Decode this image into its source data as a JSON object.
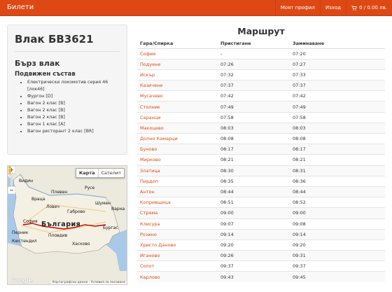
{
  "nav": {
    "brand": "Билети",
    "profile": "Моят профил",
    "logout": "Изход",
    "cart": "0 / 0.00 лв."
  },
  "train": {
    "title": "Влак БВ3621",
    "type": "Бърз влак",
    "composition_title": "Подвижен състав",
    "composition": [
      "Електрически локомотив серия 46 [лок46]",
      "Фургон [D]",
      "Вагон 2 клас [B]",
      "Вагон 2 клас [B]",
      "Вагон 2 клас [B]",
      "Вагон 1 клас [A]",
      "Вагон ресторант 2 клас [BR]"
    ]
  },
  "map": {
    "tab_map": "Карта",
    "tab_satellite": "Сателит",
    "country": "България",
    "labels": [
      "Видин",
      "Враца",
      "Плевен",
      "Русе",
      "Ловеч",
      "Габрово",
      "Шумен",
      "Варна",
      "Перник",
      "София",
      "Пловдив",
      "Бургас",
      "Кюстендил",
      "Хасково"
    ],
    "attribution": "Картографски данни - Условия за ползване",
    "google": "Google",
    "route_color": "#cc0000"
  },
  "route": {
    "title": "Маршрут",
    "headers": [
      "Гара/Спирка",
      "Пристигане",
      "Заминаване"
    ],
    "rows": [
      [
        "София",
        "-",
        "07:20"
      ],
      [
        "Подуене",
        "07:26",
        "07:27"
      ],
      [
        "Искър",
        "07:32",
        "07:33"
      ],
      [
        "Казичене",
        "07:37",
        "07:37"
      ],
      [
        "Мусачево",
        "07:42",
        "07:42"
      ],
      [
        "Столник",
        "07:49",
        "07:49"
      ],
      [
        "Саранци",
        "07:58",
        "07:58"
      ],
      [
        "Макоцево",
        "08:03",
        "08:03"
      ],
      [
        "Долно Камарци",
        "08:08",
        "08:08"
      ],
      [
        "Буново",
        "08:17",
        "08:17"
      ],
      [
        "Мирково",
        "08:21",
        "08:21"
      ],
      [
        "Злaтица",
        "08:30",
        "08:31"
      ],
      [
        "Пирдоп",
        "08:35",
        "08:36"
      ],
      [
        "Антон",
        "08:44",
        "08:44"
      ],
      [
        "Копривщица",
        "08:51",
        "08:52"
      ],
      [
        "Стряма",
        "09:00",
        "09:00"
      ],
      [
        "Клисура",
        "09:07",
        "09:08"
      ],
      [
        "Розино",
        "09:14",
        "09:14"
      ],
      [
        "Христо Даново",
        "09:20",
        "09:20"
      ],
      [
        "Иганово",
        "09:26",
        "09:31"
      ],
      [
        "Сопот",
        "09:37",
        "09:37"
      ],
      [
        "Карлово",
        "09:43",
        "09:45"
      ]
    ]
  },
  "colors": {
    "accent": "#dd4814",
    "navbar": "#dd4814"
  }
}
